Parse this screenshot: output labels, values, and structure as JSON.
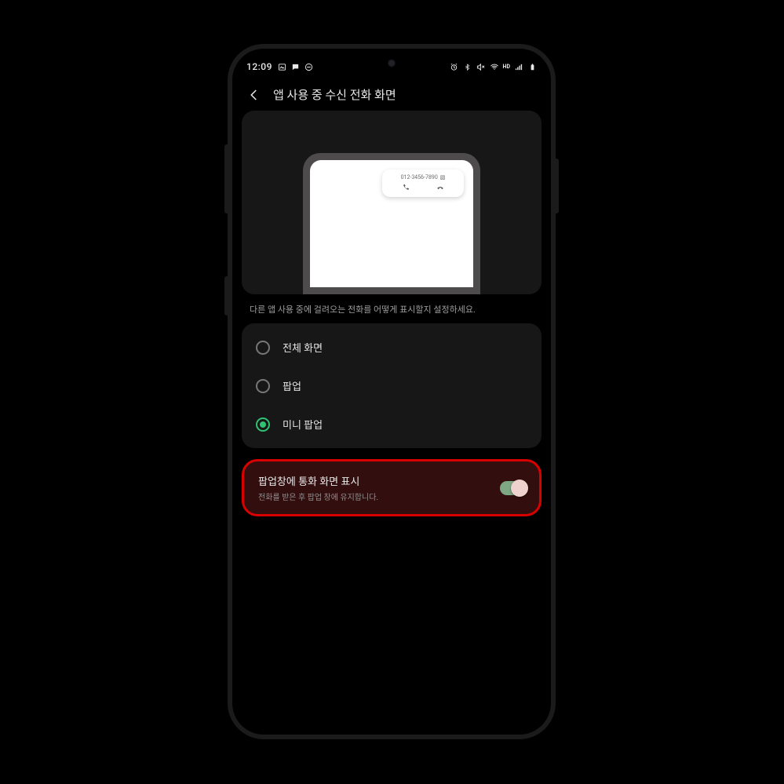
{
  "status_bar": {
    "time": "12:09",
    "hd_voice_label": "HD"
  },
  "header": {
    "title": "앱 사용 중 수신 전화 화면"
  },
  "preview": {
    "phone_number": "012-3456-7890"
  },
  "hint": "다른 앱 사용 중에 걸려오는 전화를 어떻게 표시할지 설정하세요.",
  "display_options": [
    {
      "id": "fullscreen",
      "label": "전체 화면",
      "selected": false
    },
    {
      "id": "popup",
      "label": "팝업",
      "selected": false
    },
    {
      "id": "minipopup",
      "label": "미니 팝업",
      "selected": true
    }
  ],
  "toggle": {
    "title": "팝업창에 통화 화면 표시",
    "subtitle": "전화를 받은 후 팝업 창에 유지합니다.",
    "enabled": true
  }
}
